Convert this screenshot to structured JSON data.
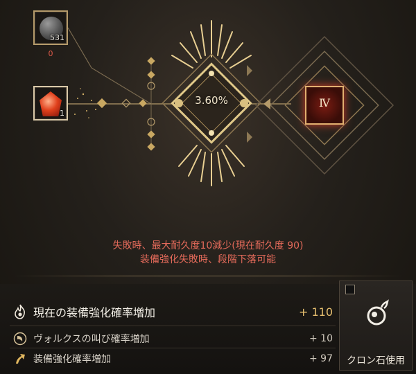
{
  "materials": {
    "stone": {
      "icon": "black-stone-icon",
      "count": "531",
      "below": "0"
    },
    "crystal": {
      "icon": "red-crystal-icon",
      "count": "1"
    }
  },
  "enhance": {
    "chance": "3.60%",
    "tier": "Ⅳ"
  },
  "warnings": {
    "line1": "失敗時、最大耐久度10減少(現在耐久度 90)",
    "line2": "装備強化失敗時、段階下落可能"
  },
  "bonus": {
    "main": {
      "icon": "flame-icon",
      "label": "現在の装備強化確率増加",
      "value": "+ 110"
    },
    "rows": [
      {
        "icon": "valks-cry-icon",
        "label": "ヴォルクスの叫び確率増加",
        "value": "+ 10"
      },
      {
        "icon": "up-arrow-icon",
        "label": "装備強化確率増加",
        "value": "+ 97"
      }
    ]
  },
  "cron": {
    "label": "クロン石使用",
    "checked": false,
    "icon": "cron-stone-icon"
  },
  "colors": {
    "gold": "#e8c070",
    "warning": "#e36a5a",
    "frame": "#b49a6a"
  }
}
